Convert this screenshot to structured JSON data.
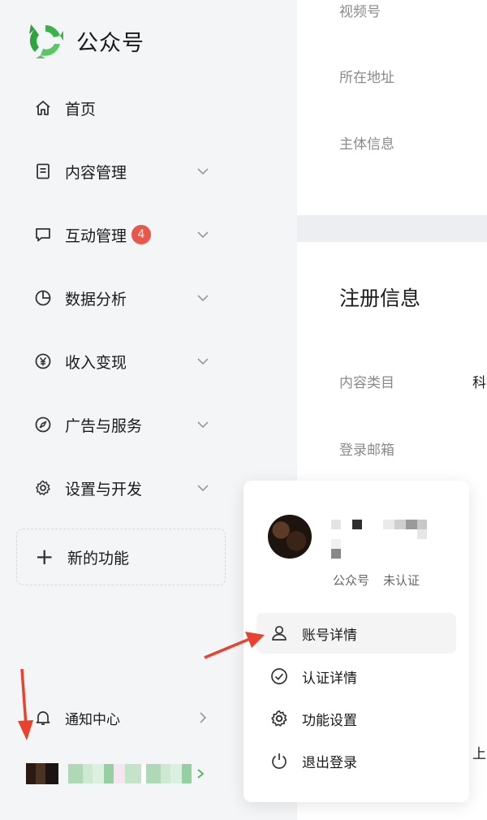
{
  "sidebar": {
    "brand": "公众号",
    "items": [
      {
        "label": "首页",
        "icon": "home-icon"
      },
      {
        "label": "内容管理",
        "icon": "document-icon"
      },
      {
        "label": "互动管理",
        "icon": "chat-icon",
        "badge": "4"
      },
      {
        "label": "数据分析",
        "icon": "pie-chart-icon"
      },
      {
        "label": "收入变现",
        "icon": "yen-icon"
      },
      {
        "label": "广告与服务",
        "icon": "compass-icon"
      },
      {
        "label": "设置与开发",
        "icon": "gear-icon"
      }
    ],
    "new_feature": "新的功能",
    "notice": "通知中心"
  },
  "main": {
    "card1_fields": [
      "视频号",
      "所在地址",
      "主体信息"
    ],
    "register_title": "注册信息",
    "register_fields": [
      "内容类目",
      "登录邮箱"
    ],
    "category_value": "科",
    "partial_value": "上"
  },
  "popup": {
    "account_type": "公众号",
    "account_status": "未认证",
    "menu": [
      {
        "label": "账号详情",
        "icon": "user-icon"
      },
      {
        "label": "认证详情",
        "icon": "check-circle-icon"
      },
      {
        "label": "功能设置",
        "icon": "gear-icon"
      },
      {
        "label": "退出登录",
        "icon": "power-icon"
      }
    ]
  },
  "colors": {
    "badge": "#e8574b",
    "annotation_arrow": "#e8432f",
    "logo_green": "#3cb34a"
  }
}
